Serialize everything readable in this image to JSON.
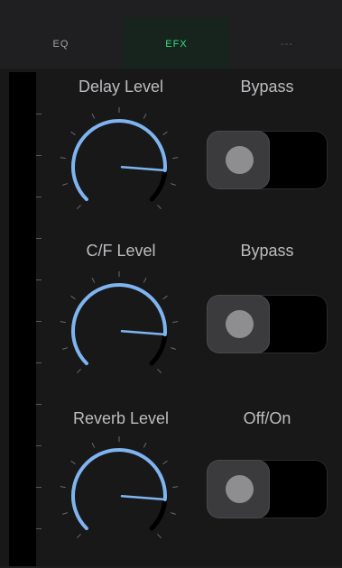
{
  "tabs": [
    {
      "label": "EQ"
    },
    {
      "label": "EFX",
      "active": true
    },
    {
      "label": "---"
    }
  ],
  "controls": [
    {
      "knob_label": "Delay Level",
      "toggle_label": "Bypass",
      "knob_level": 0.85,
      "toggle_on": false
    },
    {
      "knob_label": "C/F Level",
      "toggle_label": "Bypass",
      "knob_level": 0.85,
      "toggle_on": false
    },
    {
      "knob_label": "Reverb Level",
      "toggle_label": "Off/On",
      "knob_level": 0.85,
      "toggle_on": false
    }
  ],
  "colors": {
    "accent": "#34e07d",
    "knob_arc": "#7fb4f0",
    "knob_remaining": "#000000"
  }
}
